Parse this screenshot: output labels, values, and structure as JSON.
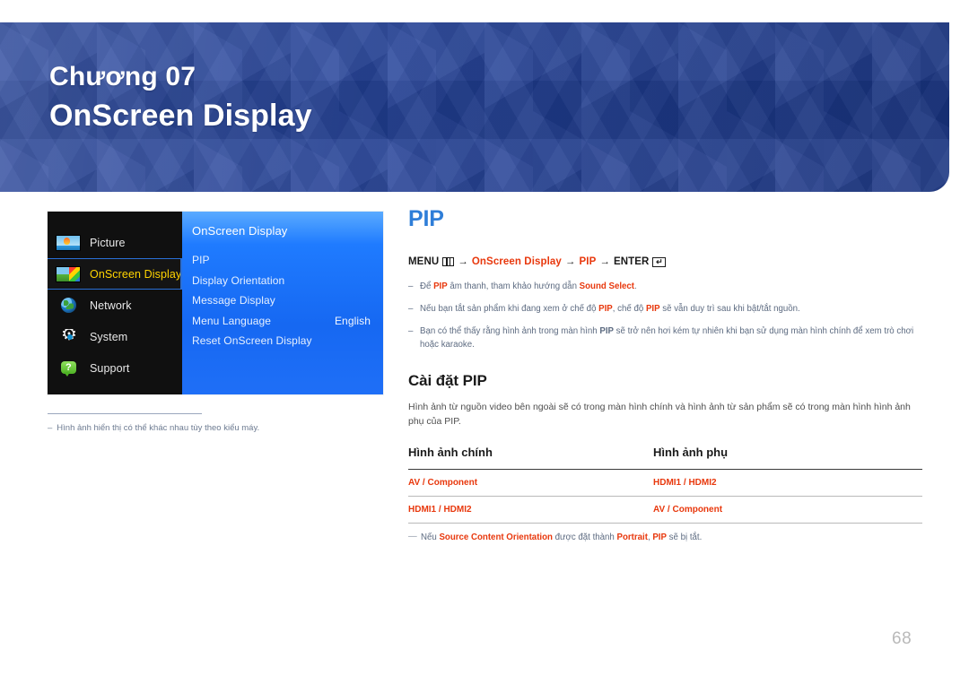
{
  "banner": {
    "kicker": "Chương 07",
    "title": "OnScreen Display",
    "bg_color": "#1e3d97"
  },
  "osd_menu": {
    "categories": [
      {
        "label": "Picture",
        "icon": "picture-thumbnail-icon",
        "selected": false
      },
      {
        "label": "OnScreen Display",
        "icon": "onscreen-display-thumbnail-icon",
        "selected": true
      },
      {
        "label": "Network",
        "icon": "globe-icon",
        "selected": false
      },
      {
        "label": "System",
        "icon": "gear-icon",
        "selected": false
      },
      {
        "label": "Support",
        "icon": "help-bubble-icon",
        "selected": false
      }
    ],
    "panel_title": "OnScreen Display",
    "items": [
      {
        "label": "PIP",
        "value": ""
      },
      {
        "label": "Display Orientation",
        "value": ""
      },
      {
        "label": "Message Display",
        "value": ""
      },
      {
        "label": "Menu Language",
        "value": "English"
      },
      {
        "label": "Reset OnScreen Display",
        "value": ""
      }
    ],
    "highlight_color": "#ffd400",
    "panel_color": "#1f7bff"
  },
  "osd_footnote": {
    "dash": "–",
    "text": "Hình ảnh hiển thị có thể khác nhau tùy theo kiểu máy."
  },
  "content": {
    "section_title": "PIP",
    "menu_path": {
      "menu_label": "MENU",
      "menu_icon": "menu-bars-icon",
      "arrow1": "→",
      "step1": "OnScreen Display",
      "arrow2": "→",
      "step2": "PIP",
      "arrow3": "→",
      "enter_label": "ENTER",
      "enter_icon": "enter-arrow-icon",
      "enter_glyph": "↵"
    },
    "notes": [
      {
        "parts": [
          {
            "t": "Để ",
            "style": "plain"
          },
          {
            "t": "PIP",
            "style": "red"
          },
          {
            "t": " âm thanh, tham khảo hướng dẫn ",
            "style": "plain"
          },
          {
            "t": "Sound Select",
            "style": "red"
          },
          {
            "t": ".",
            "style": "plain"
          }
        ]
      },
      {
        "parts": [
          {
            "t": "Nếu bạn tắt sản phẩm khi đang xem ở chế độ ",
            "style": "plain"
          },
          {
            "t": "PIP",
            "style": "red"
          },
          {
            "t": ", chế độ ",
            "style": "plain"
          },
          {
            "t": "PIP",
            "style": "red"
          },
          {
            "t": " sẽ vẫn duy trì sau khi bật/tắt nguồn.",
            "style": "plain"
          }
        ]
      },
      {
        "parts": [
          {
            "t": "Bạn có thể thấy rằng hình ảnh trong màn hình ",
            "style": "plain"
          },
          {
            "t": "PIP",
            "style": "bold-plain"
          },
          {
            "t": " sẽ trở nên hơi kém tự nhiên khi bạn sử dụng màn hình chính để xem trò chơi hoặc karaoke.",
            "style": "plain"
          }
        ]
      }
    ],
    "sub_title": "Cài đặt PIP",
    "body": "Hình ảnh từ nguồn video bên ngoài sẽ có trong màn hình chính và hình ảnh từ sản phẩm sẽ có trong màn hình hình ảnh phụ của PIP.",
    "table": {
      "headers": [
        "Hình ảnh chính",
        "Hình ảnh phụ"
      ],
      "rows": [
        [
          "AV / Component",
          "HDMI1 / HDMI2"
        ],
        [
          "HDMI1 / HDMI2",
          "AV / Component"
        ]
      ]
    },
    "tail_note": {
      "parts": [
        {
          "t": "Nếu ",
          "style": "plain"
        },
        {
          "t": "Source Content Orientation",
          "style": "red"
        },
        {
          "t": " được đặt thành ",
          "style": "plain"
        },
        {
          "t": "Portrait",
          "style": "red"
        },
        {
          "t": ", ",
          "style": "plain"
        },
        {
          "t": "PIP",
          "style": "red"
        },
        {
          "t": " sẽ bị tắt.",
          "style": "plain"
        }
      ]
    }
  },
  "page_number": "68",
  "colors": {
    "accent_blue": "#2f7ed8",
    "accent_red": "#e8380d",
    "note_gray": "#5d6b81"
  }
}
